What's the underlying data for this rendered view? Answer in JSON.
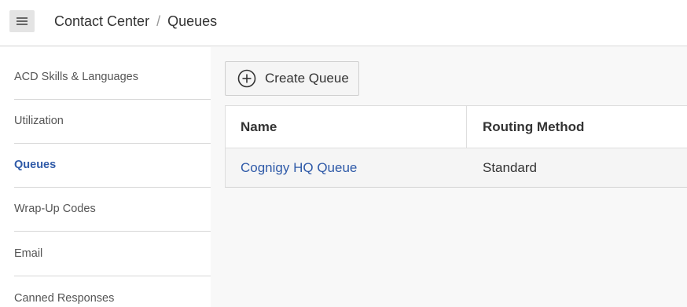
{
  "header": {
    "menu_icon": "hamburger-icon",
    "breadcrumb": [
      "Contact Center",
      "Queues"
    ],
    "separator": "/"
  },
  "sidebar": {
    "items": [
      {
        "label": "ACD Skills & Languages",
        "active": false
      },
      {
        "label": "Utilization",
        "active": false
      },
      {
        "label": "Queues",
        "active": true
      },
      {
        "label": "Wrap-Up Codes",
        "active": false
      },
      {
        "label": "Email",
        "active": false
      },
      {
        "label": "Canned Responses",
        "active": false
      }
    ]
  },
  "toolbar": {
    "create_label": "Create Queue",
    "create_icon": "plus-circle-icon"
  },
  "table": {
    "columns": [
      "Name",
      "Routing Method"
    ],
    "rows": [
      {
        "name": "Cognigy HQ Queue",
        "routing": "Standard"
      }
    ]
  },
  "colors": {
    "accent": "#2f5aa8",
    "text": "#333333",
    "muted": "#555555"
  }
}
